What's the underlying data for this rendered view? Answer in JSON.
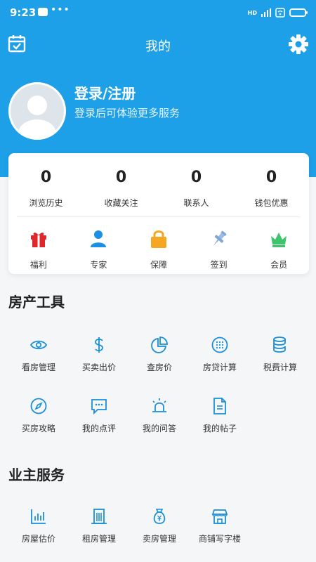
{
  "status_bar": {
    "time": "9:23",
    "dots": "•••",
    "network_label": "HD"
  },
  "header": {
    "title": "我的"
  },
  "profile": {
    "login_label": "登录/注册",
    "subtitle": "登录后可体验更多服务"
  },
  "stats": [
    {
      "value": "0",
      "label": "浏览历史"
    },
    {
      "value": "0",
      "label": "收藏关注"
    },
    {
      "value": "0",
      "label": "联系人"
    },
    {
      "value": "0",
      "label": "钱包优惠"
    }
  ],
  "quick_icons": [
    {
      "label": "福利",
      "icon": "gift-icon",
      "color": "#e0262b"
    },
    {
      "label": "专家",
      "icon": "person-icon",
      "color": "#1a8fe3"
    },
    {
      "label": "保障",
      "icon": "lock-icon",
      "color": "#f5a623"
    },
    {
      "label": "签到",
      "icon": "pin-icon",
      "color": "#7fa6d6"
    },
    {
      "label": "会员",
      "icon": "crown-icon",
      "color": "#3ec46d"
    }
  ],
  "real_estate_tools": {
    "title": "房产工具",
    "items": [
      {
        "label": "看房管理",
        "icon": "eye-icon"
      },
      {
        "label": "买卖出价",
        "icon": "dollar-icon"
      },
      {
        "label": "查房价",
        "icon": "pie-chart-icon"
      },
      {
        "label": "房贷计算",
        "icon": "calculator-icon"
      },
      {
        "label": "税费计算",
        "icon": "coins-icon"
      },
      {
        "label": "买房攻略",
        "icon": "compass-icon"
      },
      {
        "label": "我的点评",
        "icon": "comment-icon"
      },
      {
        "label": "我的问答",
        "icon": "alarm-icon"
      },
      {
        "label": "我的帖子",
        "icon": "document-icon"
      }
    ]
  },
  "owner_services": {
    "title": "业主服务",
    "items": [
      {
        "label": "房屋估价",
        "icon": "bar-chart-icon"
      },
      {
        "label": "租房管理",
        "icon": "building-icon"
      },
      {
        "label": "卖房管理",
        "icon": "money-bag-icon"
      },
      {
        "label": "商铺写字楼",
        "icon": "store-icon"
      }
    ]
  },
  "colors": {
    "primary": "#1da0e8",
    "tool_icon": "#1a8fd8",
    "background": "#f4f6f8"
  }
}
